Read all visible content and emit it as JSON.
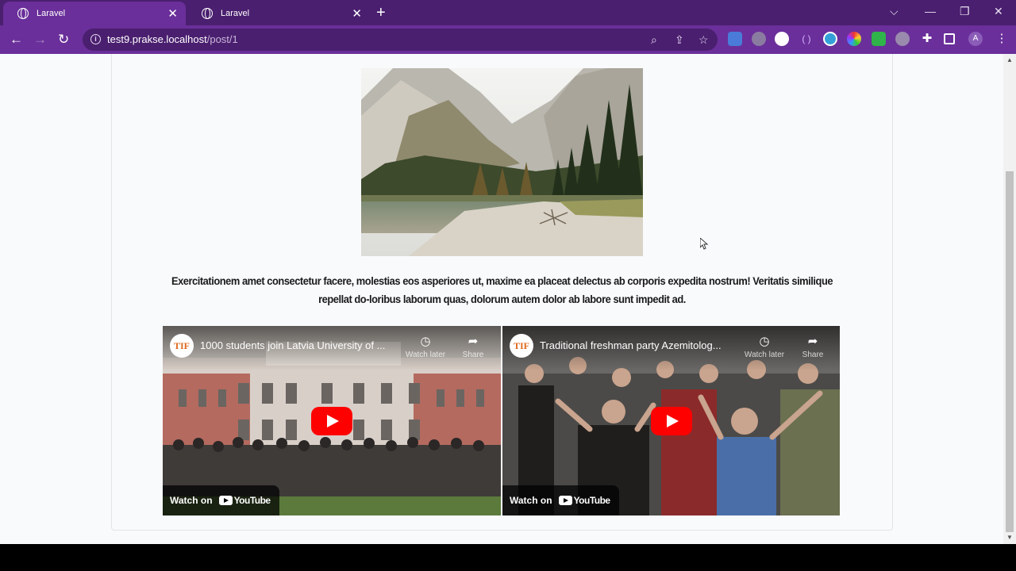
{
  "browser": {
    "tabs": [
      {
        "title": "Laravel",
        "active": true
      },
      {
        "title": "Laravel",
        "active": false
      }
    ],
    "url_host": "test9.prakse.localhost",
    "url_path": "/post/1",
    "profile_initial": "A",
    "colors": {
      "frame": "#4a1f6f",
      "toolbar": "#6a2f9a"
    }
  },
  "post": {
    "description": "Exercitationem amet consectetur facere, molestias eos asperiores ut, maxime ea placeat delectus ab corporis expedita nostrum! Veritatis similique repellat do-loribus laborum quas, dolorum autem dolor ab labore sunt impedit ad.",
    "videos": [
      {
        "channel": "TIF",
        "title": "1000 students join Latvia University of ...",
        "watch_later": "Watch later",
        "share": "Share",
        "watch_on": "Watch on",
        "platform": "YouTube"
      },
      {
        "channel": "TIF",
        "title": "Traditional freshman party Azemitolog...",
        "watch_later": "Watch later",
        "share": "Share",
        "watch_on": "Watch on",
        "platform": "YouTube"
      }
    ]
  }
}
